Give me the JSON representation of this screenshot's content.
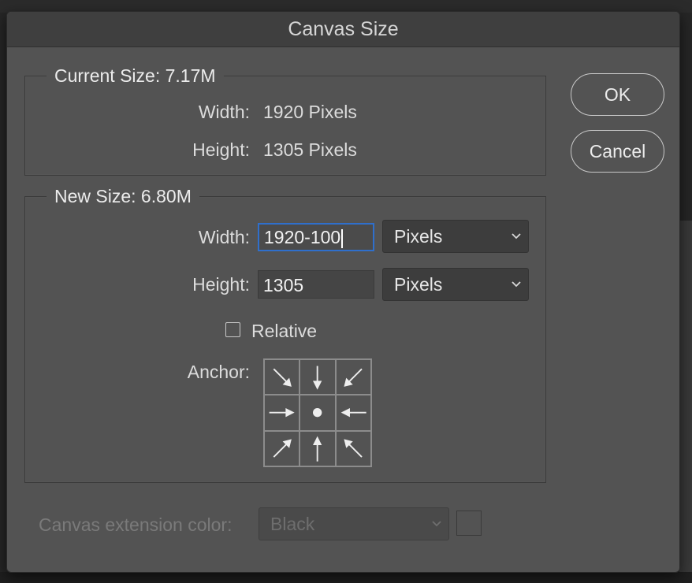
{
  "dialog": {
    "title": "Canvas Size"
  },
  "current_size": {
    "legend": "Current Size: 7.17M",
    "width_label": "Width:",
    "width_value": "1920 Pixels",
    "height_label": "Height:",
    "height_value": "1305 Pixels"
  },
  "new_size": {
    "legend": "New Size: 6.80M",
    "width_label": "Width:",
    "width_value": "1920-100",
    "width_unit": "Pixels",
    "height_label": "Height:",
    "height_value": "1305",
    "height_unit": "Pixels",
    "relative_label": "Relative",
    "relative_checked": false,
    "anchor_label": "Anchor:"
  },
  "buttons": {
    "ok": "OK",
    "cancel": "Cancel"
  },
  "extension": {
    "label": "Canvas extension color:",
    "value": "Black",
    "disabled": true
  },
  "colors": {
    "dialog_bg": "#535353",
    "titlebar_bg": "#3f3f3f",
    "focus_ring": "#2f6fcc"
  }
}
